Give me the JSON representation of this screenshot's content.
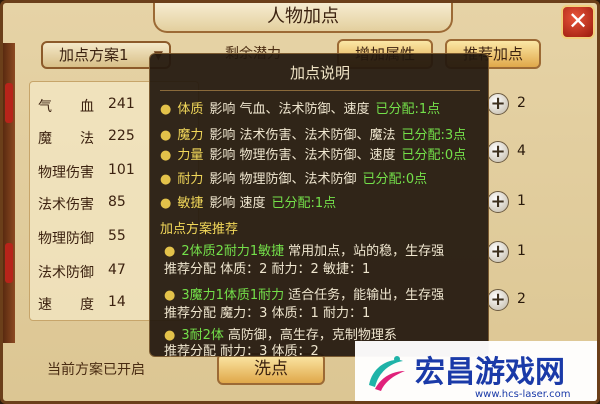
{
  "window": {
    "title": "人物加点",
    "close_label": "✕"
  },
  "toolbar": {
    "scheme_select": "加点方案1",
    "remaining_points_label": "剩余潜力",
    "apply_label": "增加属性",
    "recommend_label": "推荐加点"
  },
  "stats": [
    {
      "label": "气　　血",
      "value": "241"
    },
    {
      "label": "魔　　法",
      "value": "225"
    },
    {
      "label": "物理伤害",
      "value": "101"
    },
    {
      "label": "法术伤害",
      "value": "85"
    },
    {
      "label": "物理防御",
      "value": "55"
    },
    {
      "label": "法术防御",
      "value": "47"
    },
    {
      "label": "速　　度",
      "value": "14"
    }
  ],
  "allocations": [
    "2",
    "4",
    "1",
    "1",
    "2"
  ],
  "footer": {
    "status": "当前方案已开启",
    "wash_label": "洗点"
  },
  "popup": {
    "title": "加点说明",
    "attributes": [
      {
        "name": "体质",
        "desc": "影响 气血、法术防御、速度",
        "alloc": "已分配:1点"
      },
      {
        "name": "魔力",
        "desc": "影响 法术伤害、法术防御、魔法",
        "alloc": "已分配:3点"
      },
      {
        "name": "力量",
        "desc": "影响 物理伤害、法术防御、速度",
        "alloc": "已分配:0点"
      },
      {
        "name": "耐力",
        "desc": "影响 物理防御、法术防御",
        "alloc": "已分配:0点"
      },
      {
        "name": "敏捷",
        "desc": "影响 速度",
        "alloc": "已分配:1点"
      }
    ],
    "recommend_title": "加点方案推荐",
    "plans": [
      {
        "name": "2体质2耐力1敏捷",
        "desc": "常用加点，站的稳，生存强",
        "detail": "推荐分配 体质：2 耐力：2 敏捷：1"
      },
      {
        "name": "3魔力1体质1耐力",
        "desc": "适合任务，能输出，生存强",
        "detail": "推荐分配 魔力：3 体质：1 耐力：1"
      },
      {
        "name": "3耐2体",
        "desc": "高防御，高生存，克制物理系",
        "detail": "推荐分配 耐力：3 体质：2"
      }
    ]
  },
  "watermark": {
    "title": "宏昌游戏网",
    "url": "www.hcs-laser.com"
  }
}
